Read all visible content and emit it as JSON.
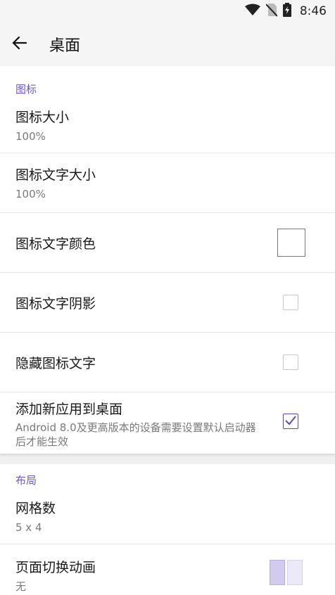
{
  "status_bar": {
    "time": "8:46",
    "icons": [
      "wifi-icon",
      "no-sim-icon",
      "battery-charging-icon"
    ]
  },
  "app_bar": {
    "title": "桌面",
    "back_icon": "arrow-left-icon"
  },
  "sections": {
    "icons": {
      "header": "图标",
      "icon_size": {
        "title": "图标大小",
        "value": "100%"
      },
      "icon_text_size": {
        "title": "图标文字大小",
        "value": "100%"
      },
      "icon_text_color": {
        "title": "图标文字颜色",
        "swatch_color": "#ffffff"
      },
      "icon_text_shadow": {
        "title": "图标文字阴影",
        "checked": false
      },
      "hide_icon_text": {
        "title": "隐藏图标文字",
        "checked": false
      },
      "add_new_apps": {
        "title": "添加新应用到桌面",
        "summary": "Android 8.0及更高版本的设备需要设置默认启动器后才能生效",
        "checked": true
      }
    },
    "layout": {
      "header": "布局",
      "grid_count": {
        "title": "网格数",
        "value": "5 x 4"
      },
      "page_transition": {
        "title": "页面切换动画",
        "value": "无"
      }
    }
  },
  "colors": {
    "accent": "#6a5acd",
    "checkbox_checked": "#5b4bb7",
    "background": "#f0f0f0"
  }
}
